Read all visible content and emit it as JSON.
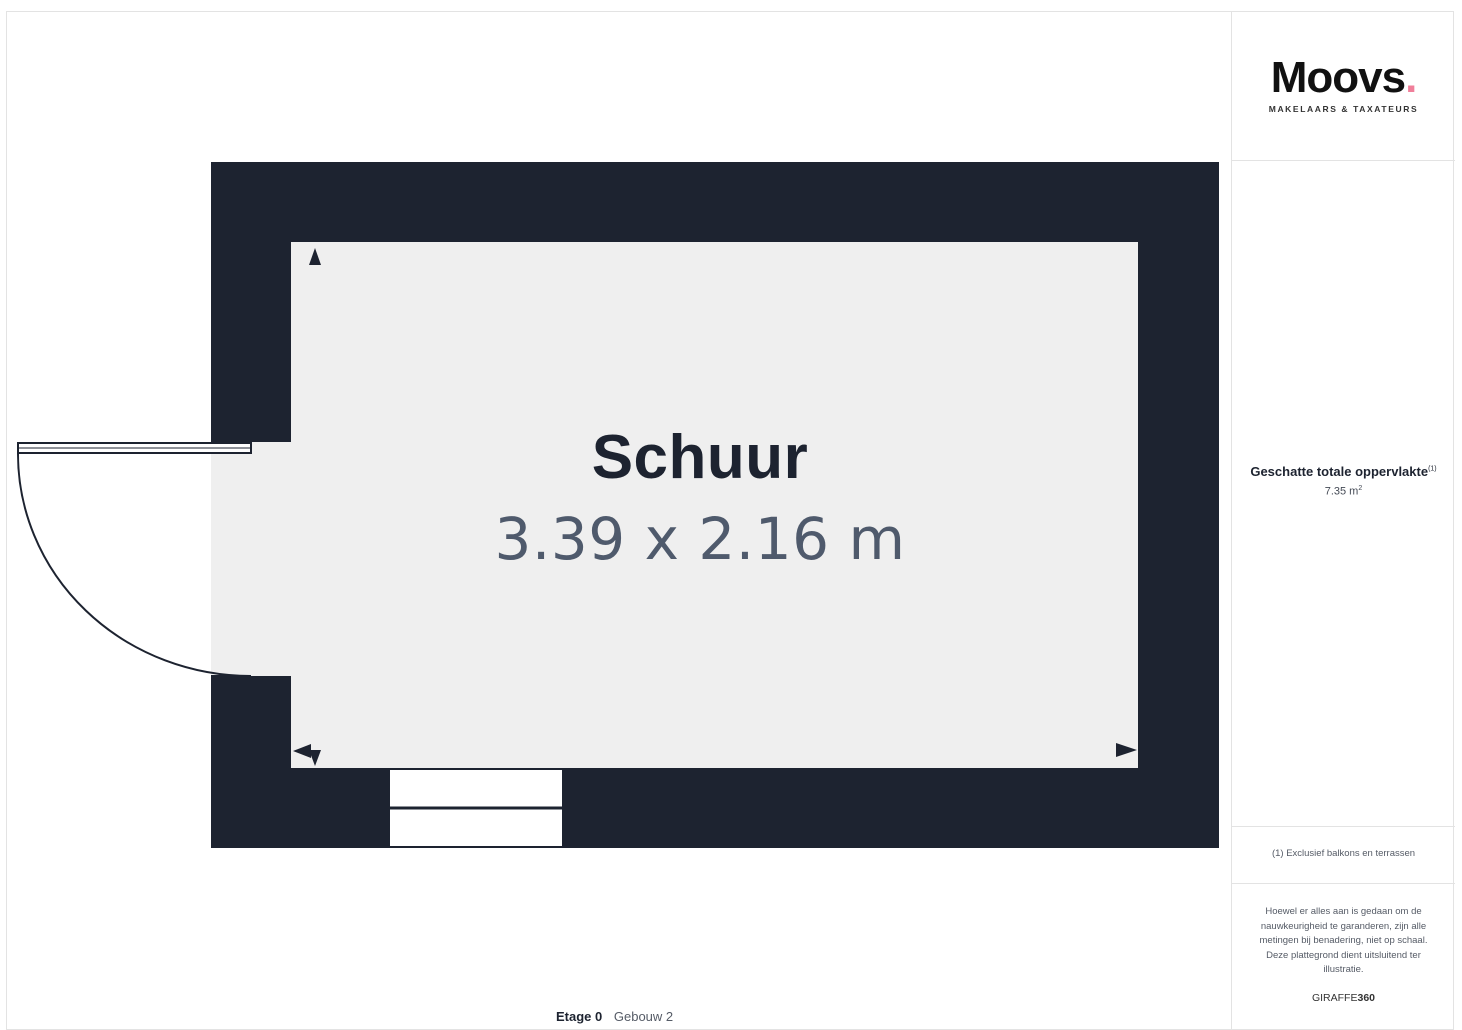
{
  "room": {
    "name": "Schuur",
    "dimensions": "3.39 x 2.16 m"
  },
  "footer": {
    "floor": "Etage 0",
    "building": "Gebouw 2"
  },
  "sidebar": {
    "logo_word": "Moovs",
    "logo_dot": ".",
    "logo_sub": "MAKELAARS & TAXATEURS",
    "area_title": "Geschatte totale oppervlakte",
    "area_title_note": "(1)",
    "area_value": "7.35 m",
    "area_unit_sup": "2",
    "footnote": "(1) Exclusief balkons en terrassen",
    "disclaimer": "Hoewel er alles aan is gedaan om de nauwkeurigheid te garanderen, zijn alle metingen bij benadering, niet op schaal. Deze plattegrond dient uitsluitend ter illustratie.",
    "brand_word": "GIRAFFE",
    "brand_num": "360"
  },
  "colors": {
    "wall": "#1d2330",
    "floor": "#efefef",
    "accent_dot": "#f07f9a"
  },
  "icons": {
    "door": "door-swing-icon",
    "window": "window-icon",
    "measure_arrows": "measure-arrow-icon"
  }
}
